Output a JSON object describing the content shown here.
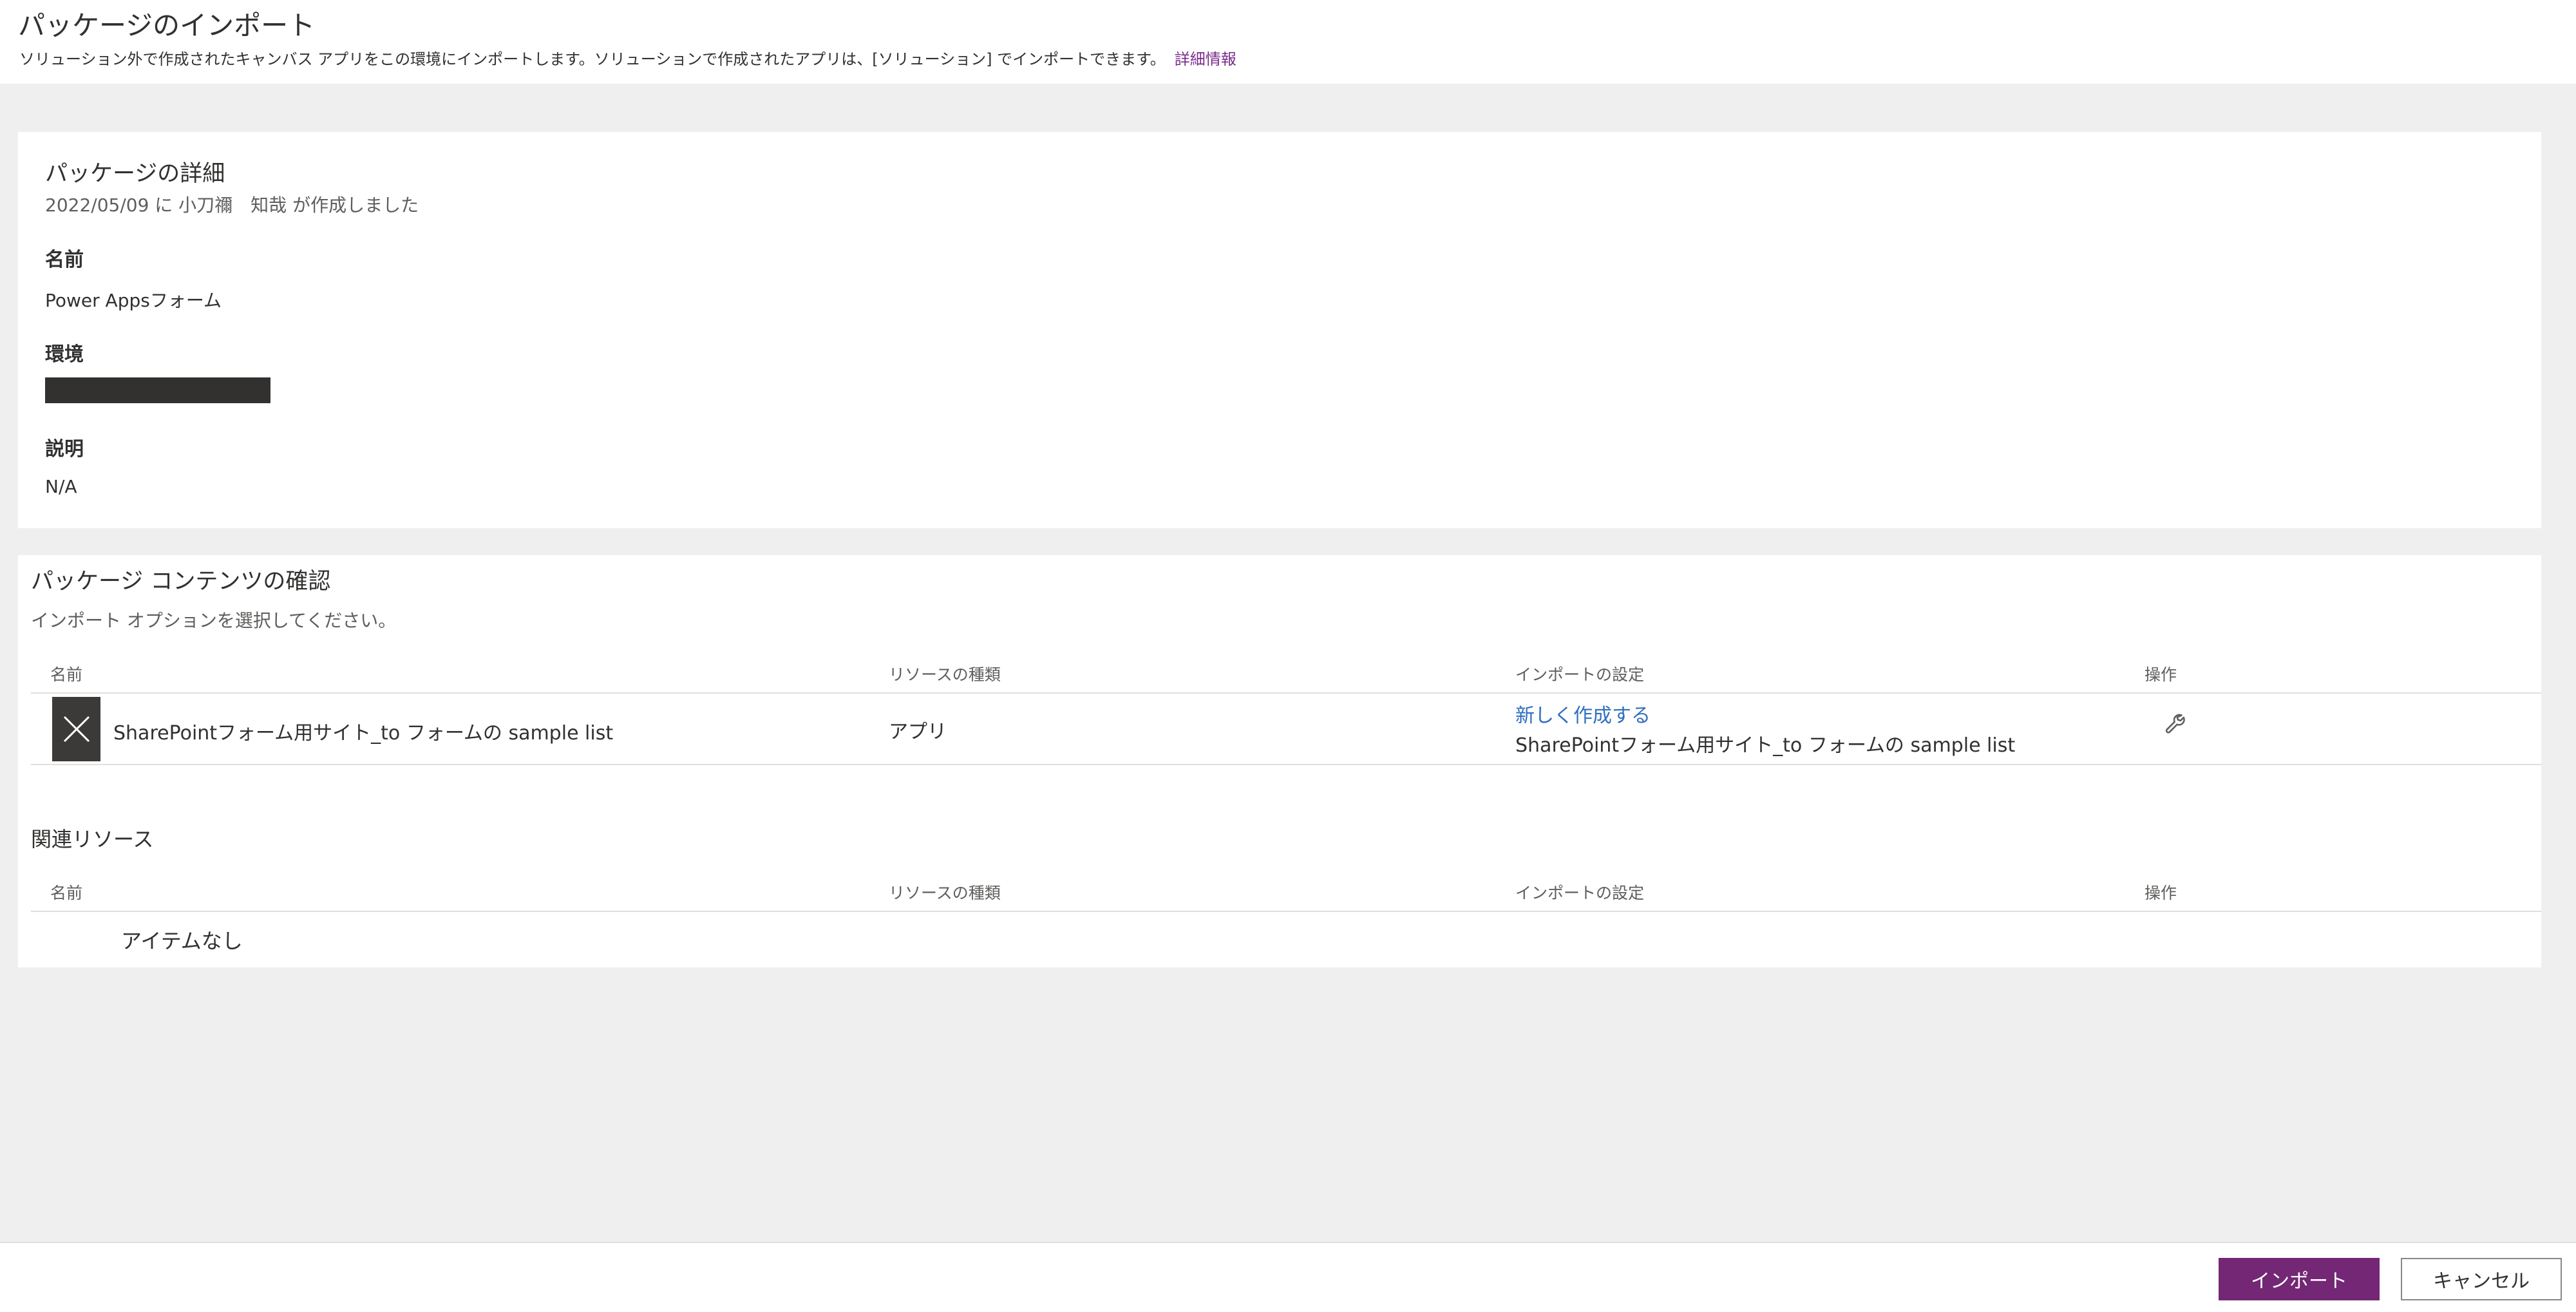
{
  "header": {
    "title": "パッケージのインポート",
    "description": "ソリューション外で作成されたキャンバス アプリをこの環境にインポートします。ソリューションで作成されたアプリは、[ソリューション] でインポートできます。",
    "learn_more": "詳細情報"
  },
  "details": {
    "title": "パッケージの詳細",
    "created": "2022/05/09 に 小刀禰　知哉 が作成しました",
    "name_label": "名前",
    "name_value": "Power Appsフォーム",
    "env_label": "環境",
    "desc_label": "説明",
    "desc_value": "N/A"
  },
  "contents": {
    "title": "パッケージ コンテンツの確認",
    "instruction": "インポート オプションを選択してください。",
    "columns": [
      "名前",
      "リソースの種類",
      "インポートの設定",
      "操作"
    ],
    "rows": [
      {
        "name": "SharePointフォーム用サイト_to フォームの sample list",
        "type": "アプリ",
        "setting_link": "新しく作成する",
        "setting_detail": "SharePointフォーム用サイト_to フォームの sample list"
      }
    ]
  },
  "related": {
    "title": "関連リソース",
    "columns": [
      "名前",
      "リソースの種類",
      "インポートの設定",
      "操作"
    ],
    "empty_text": "アイテムなし"
  },
  "footer": {
    "import_label": "インポート",
    "cancel_label": "キャンセル"
  },
  "colors": {
    "accent": "#742774",
    "link": "#2f6fbf",
    "background": "#efefef"
  },
  "icons": [
    "app-icon",
    "wrench-icon"
  ]
}
